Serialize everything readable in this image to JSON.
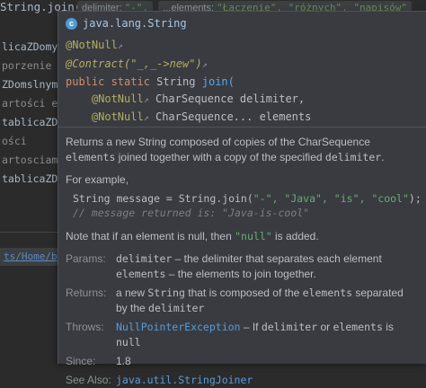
{
  "editor": {
    "top_code": "String.join(",
    "hints": [
      {
        "name": "delimiter:",
        "value": "\"-\","
      },
      {
        "name": "...elements:",
        "value": "\"Łączenie\", \"różnych\", \"napisów\""
      }
    ],
    "left_lines": [
      "licaZDomy",
      "porzenie t",
      "ZDomslnymi",
      "artości el",
      "tablicaZD",
      "ości",
      "artosciami",
      "tablicaZD"
    ],
    "status_path": "ts/Home/b"
  },
  "popup": {
    "class_name": "java.lang.String",
    "signature": {
      "ann1": "@NotNull",
      "ann2": "@Contract",
      "ann2_args": "(\"_,_->new\")",
      "decl_kw": "public static",
      "decl_type": "String",
      "decl_name": "join(",
      "param1_ann": "@NotNull",
      "param1": "CharSequence delimiter,",
      "param2_ann": "@NotNull",
      "param2": "CharSequence... elements"
    },
    "desc_1": "Returns a new String composed of copies of the CharSequence",
    "desc_2a": "elements",
    "desc_2b": " joined together with a copy of the specified ",
    "desc_2c": "delimiter",
    "desc_2d": ".",
    "example_label": "For example,",
    "example_code_1": "String message = String.join(",
    "example_code_1_args": "\"-\", \"Java\", \"is\", \"cool\"",
    "example_code_1_end": ");",
    "example_comment": "// message returned is: \"Java-is-cool\"",
    "null_note_pre": "Note that if an element is null, then ",
    "null_note_code": "\"null\"",
    "null_note_post": " is added.",
    "params_label": "Params:",
    "params_1_code": "delimiter",
    "params_1_text": " – the delimiter that separates each element",
    "params_2_code": "elements",
    "params_2_text": " – the elements to join together.",
    "returns_label": "Returns:",
    "returns_1a": "a new ",
    "returns_1b": "String",
    "returns_1c": " that is composed of the ",
    "returns_1d": "elements",
    "returns_1e": " separated",
    "returns_2a": "by the ",
    "returns_2b": "delimiter",
    "throws_label": "Throws:",
    "throws_link": "NullPointerException",
    "throws_1": " – If ",
    "throws_code1": "delimiter",
    "throws_2": " or ",
    "throws_code2": "elements",
    "throws_3": " is",
    "throws_line2": "null",
    "since_label": "Since:",
    "since_value": "1.8",
    "seealso_label": "See Also:",
    "seealso_link": "java.util.StringJoiner"
  }
}
